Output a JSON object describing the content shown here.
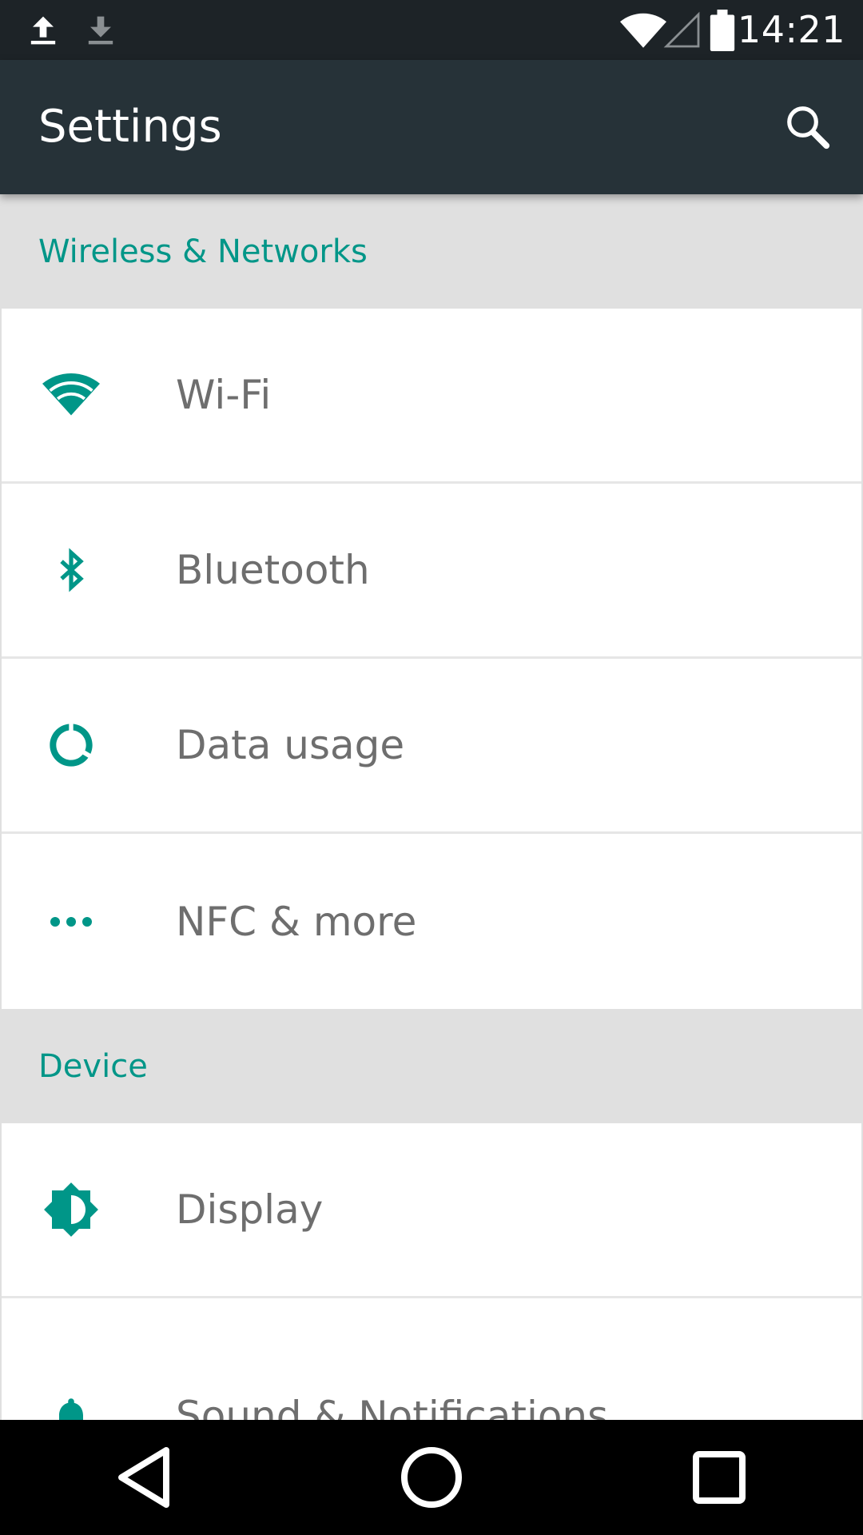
{
  "status_bar": {
    "time": "14:21",
    "icons": [
      "upload-icon",
      "download-icon",
      "wifi-signal-icon",
      "cell-signal-icon",
      "battery-icon"
    ]
  },
  "app_bar": {
    "title": "Settings",
    "search_icon": "search-icon"
  },
  "sections": [
    {
      "header": "Wireless & Networks",
      "items": [
        {
          "label": "Wi-Fi",
          "icon": "wifi-icon"
        },
        {
          "label": "Bluetooth",
          "icon": "bluetooth-icon"
        },
        {
          "label": "Data usage",
          "icon": "data-usage-icon"
        },
        {
          "label": "NFC & more",
          "icon": "more-dots-icon"
        }
      ]
    },
    {
      "header": "Device",
      "items": [
        {
          "label": "Display",
          "icon": "brightness-icon"
        },
        {
          "label": "Sound & Notifications",
          "icon": "bell-icon"
        }
      ]
    }
  ],
  "nav_bar": {
    "buttons": [
      "back-icon",
      "home-icon",
      "recents-icon"
    ]
  },
  "colors": {
    "accent": "#009688",
    "app_bar": "#263238",
    "status_bar": "#1d2327",
    "section_bg": "#e0e0e0",
    "item_text": "#6e6e6e"
  }
}
